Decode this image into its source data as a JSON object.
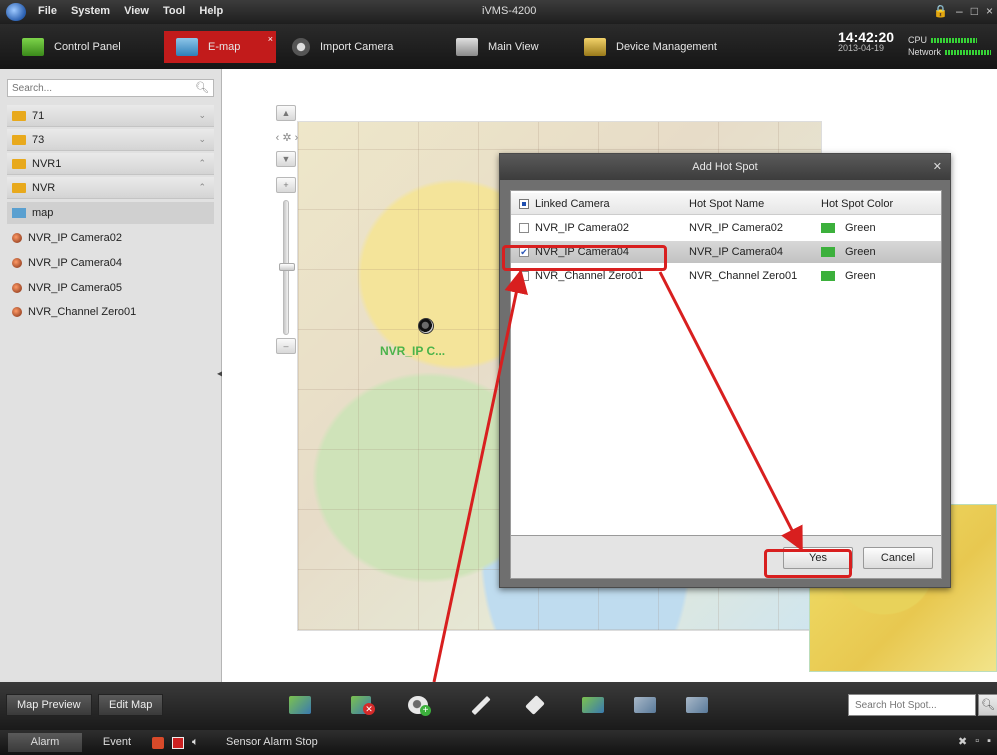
{
  "window": {
    "title": "iVMS-4200",
    "menu": [
      "File",
      "System",
      "View",
      "Tool",
      "Help"
    ],
    "controls": [
      "🔒",
      "–",
      "□",
      "×"
    ]
  },
  "tabs": [
    {
      "label": "Control Panel"
    },
    {
      "label": "E-map"
    },
    {
      "label": "Import Camera"
    },
    {
      "label": "Main View"
    },
    {
      "label": "Device Management"
    }
  ],
  "clock": {
    "time": "14:42:20",
    "date": "2013-04-19"
  },
  "perf": {
    "cpu_label": "CPU",
    "network_label": "Network"
  },
  "sidebar": {
    "search_placeholder": "Search...",
    "tree": [
      {
        "label": "71",
        "type": "folder",
        "chevron": "⌄"
      },
      {
        "label": "73",
        "type": "folder",
        "chevron": "⌄"
      },
      {
        "label": "NVR1",
        "type": "folder",
        "chevron": "⌃"
      },
      {
        "label": "NVR",
        "type": "folder",
        "chevron": "⌃"
      },
      {
        "label": "map",
        "type": "map"
      },
      {
        "label": "NVR_IP Camera02",
        "type": "camera"
      },
      {
        "label": "NVR_IP Camera04",
        "type": "camera"
      },
      {
        "label": "NVR_IP Camera05",
        "type": "camera"
      },
      {
        "label": "NVR_Channel Zero01",
        "type": "camera"
      }
    ]
  },
  "map": {
    "hotspot_label": "NVR_IP C..."
  },
  "dialog": {
    "title": "Add Hot Spot",
    "columns": [
      "Linked Camera",
      "Hot Spot Name",
      "Hot Spot Color"
    ],
    "rows": [
      {
        "camera": "NVR_IP Camera02",
        "name": "NVR_IP Camera02",
        "color": "Green",
        "checked": false
      },
      {
        "camera": "NVR_IP Camera04",
        "name": "NVR_IP Camera04",
        "color": "Green",
        "checked": true
      },
      {
        "camera": "NVR_Channel Zero01",
        "name": "NVR_Channel Zero01",
        "color": "Green",
        "checked": false
      }
    ],
    "yes_label": "Yes",
    "cancel_label": "Cancel",
    "swatch_color": "#3cb03c"
  },
  "bottom": {
    "map_preview_label": "Map Preview",
    "edit_map_label": "Edit Map",
    "search_placeholder": "Search Hot Spot...",
    "tools": [
      "add-map-icon",
      "delete-map-icon",
      "add-camera-icon",
      "modify-icon",
      "delete-icon",
      "add-hot-region-icon",
      "modify-hot-region-icon",
      "delete-hot-region-icon"
    ]
  },
  "status": {
    "alarm_tab": "Alarm",
    "event_tab": "Event",
    "text": "Sensor Alarm  Stop"
  },
  "accent_red": "#c21b1b"
}
